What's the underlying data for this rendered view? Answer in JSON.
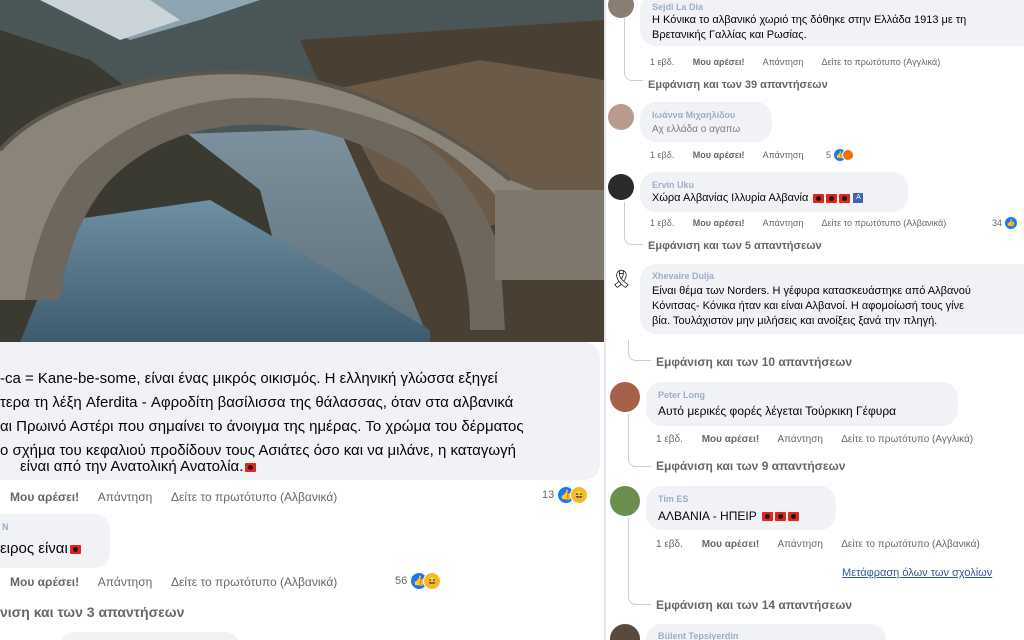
{
  "left": {
    "main_comment": {
      "lines": [
        "-ca = Kane-be-some, είναι ένας μικρός οικισμός. Η ελληνική γλώσσα εξηγεί",
        "τερα τη λέξη Aferdita - Αφροδίτη βασίλισσα της θάλασσας, όταν στα αλβανικά",
        "αι Πρωινό Αστέρι που σημαίνει το άνοιγμα της ημέρας. Το χρώμα του δέρματος",
        "ο σχήμα του κεφαλιού προδίδουν τους Ασιάτες όσο και να μιλάνε, η καταγωγή",
        "είναι από την Ανατολική Ανατολία."
      ],
      "actions": {
        "like": "Μου αρέσει!",
        "reply": "Απάντηση",
        "original": "Δείτε το πρωτότυπο (Αλβανικά)"
      },
      "reactions_count": "13"
    },
    "comment2": {
      "text": "ειρος είναι",
      "actions": {
        "like": "Μου αρέσει!",
        "reply": "Απάντηση",
        "original": "Δείτε το πρωτότυπο (Αλβανικά)"
      },
      "reactions_count": "56"
    },
    "more_replies": "νιση και των 3 απαντήσεων"
  },
  "right": {
    "c1": {
      "name": "Sejdi La Dia",
      "lines": [
        "Η Κόνικα το αλβανικό χωριό της δόθηκε στην Ελλάδα 1913 με τη",
        "Βρετανικής Γαλλίας και Ρωσίας."
      ],
      "actions": {
        "time": "1 εβδ.",
        "like": "Μου αρέσει!",
        "reply": "Απάντηση",
        "original": "Δείτε το πρωτότυπο (Αγγλικά)"
      },
      "more": "Εμφάνιση και των 39 απαντήσεων"
    },
    "c2": {
      "name": "Ιωάννα Μιχαηλίδου",
      "text": "Αχ ελλάδα ο αγαπω",
      "actions": {
        "time": "1 εβδ.",
        "like": "Μου αρέσει!",
        "reply": "Απάντηση"
      },
      "reactions_count": "5"
    },
    "c3": {
      "name": "Ervin Uku",
      "text": "Χώρα Αλβανίας Ιλλυρία Αλβανία",
      "actions": {
        "time": "1 εβδ.",
        "like": "Μου αρέσει!",
        "reply": "Απάντηση",
        "original": "Δείτε το πρωτότυπο (Αλβανικά)"
      },
      "reactions_count": "34",
      "more": "Εμφάνιση και των 5 απαντήσεων"
    },
    "c4": {
      "name": "Xhevaire Dulja",
      "lines": [
        "Είναι θέμα των Norders. Η γέφυρα κατασκευάστηκε από Αλβανού",
        "Κόνιτσας- Κόνικα ήταν και είναι Αλβανοί. Η αφομοίωσή τους γίνε",
        "βία. Τουλάχιστον μην μιλήσεις και ανοίξεις ξανά την πληγή."
      ],
      "more": "Εμφάνιση και των 10 απαντήσεων"
    },
    "c5": {
      "name": "Peter Long",
      "text": "Αυτό μερικές φορές λέγεται Τούρκικη Γέφυρα",
      "actions": {
        "time": "1 εβδ.",
        "like": "Μου αρέσει!",
        "reply": "Απάντηση",
        "original": "Δείτε το πρωτότυπο (Αγγλικά)"
      },
      "more": "Εμφάνιση και των 9 απαντήσεων"
    },
    "c6": {
      "name": "Tim ES",
      "text": "ΑΛΒΑΝΙΑ - ΗΠΕΙΡ",
      "actions": {
        "time": "1 εβδ.",
        "like": "Μου αρέσει!",
        "reply": "Απάντηση",
        "original": "Δείτε το πρωτότυπο (Αλβανικά)"
      },
      "translate_all": "Μετάφραση όλων των σχολίων",
      "more": "Εμφάνιση και των 14 απαντήσεων"
    },
    "c7": {
      "name": "Bülent Tepsiyerdin"
    }
  },
  "colors": {
    "link": "#385898",
    "like_blue": "#1877f2",
    "bubble": "#f0f2f5",
    "meta": "#65676b",
    "flag_red": "#e0261c"
  }
}
